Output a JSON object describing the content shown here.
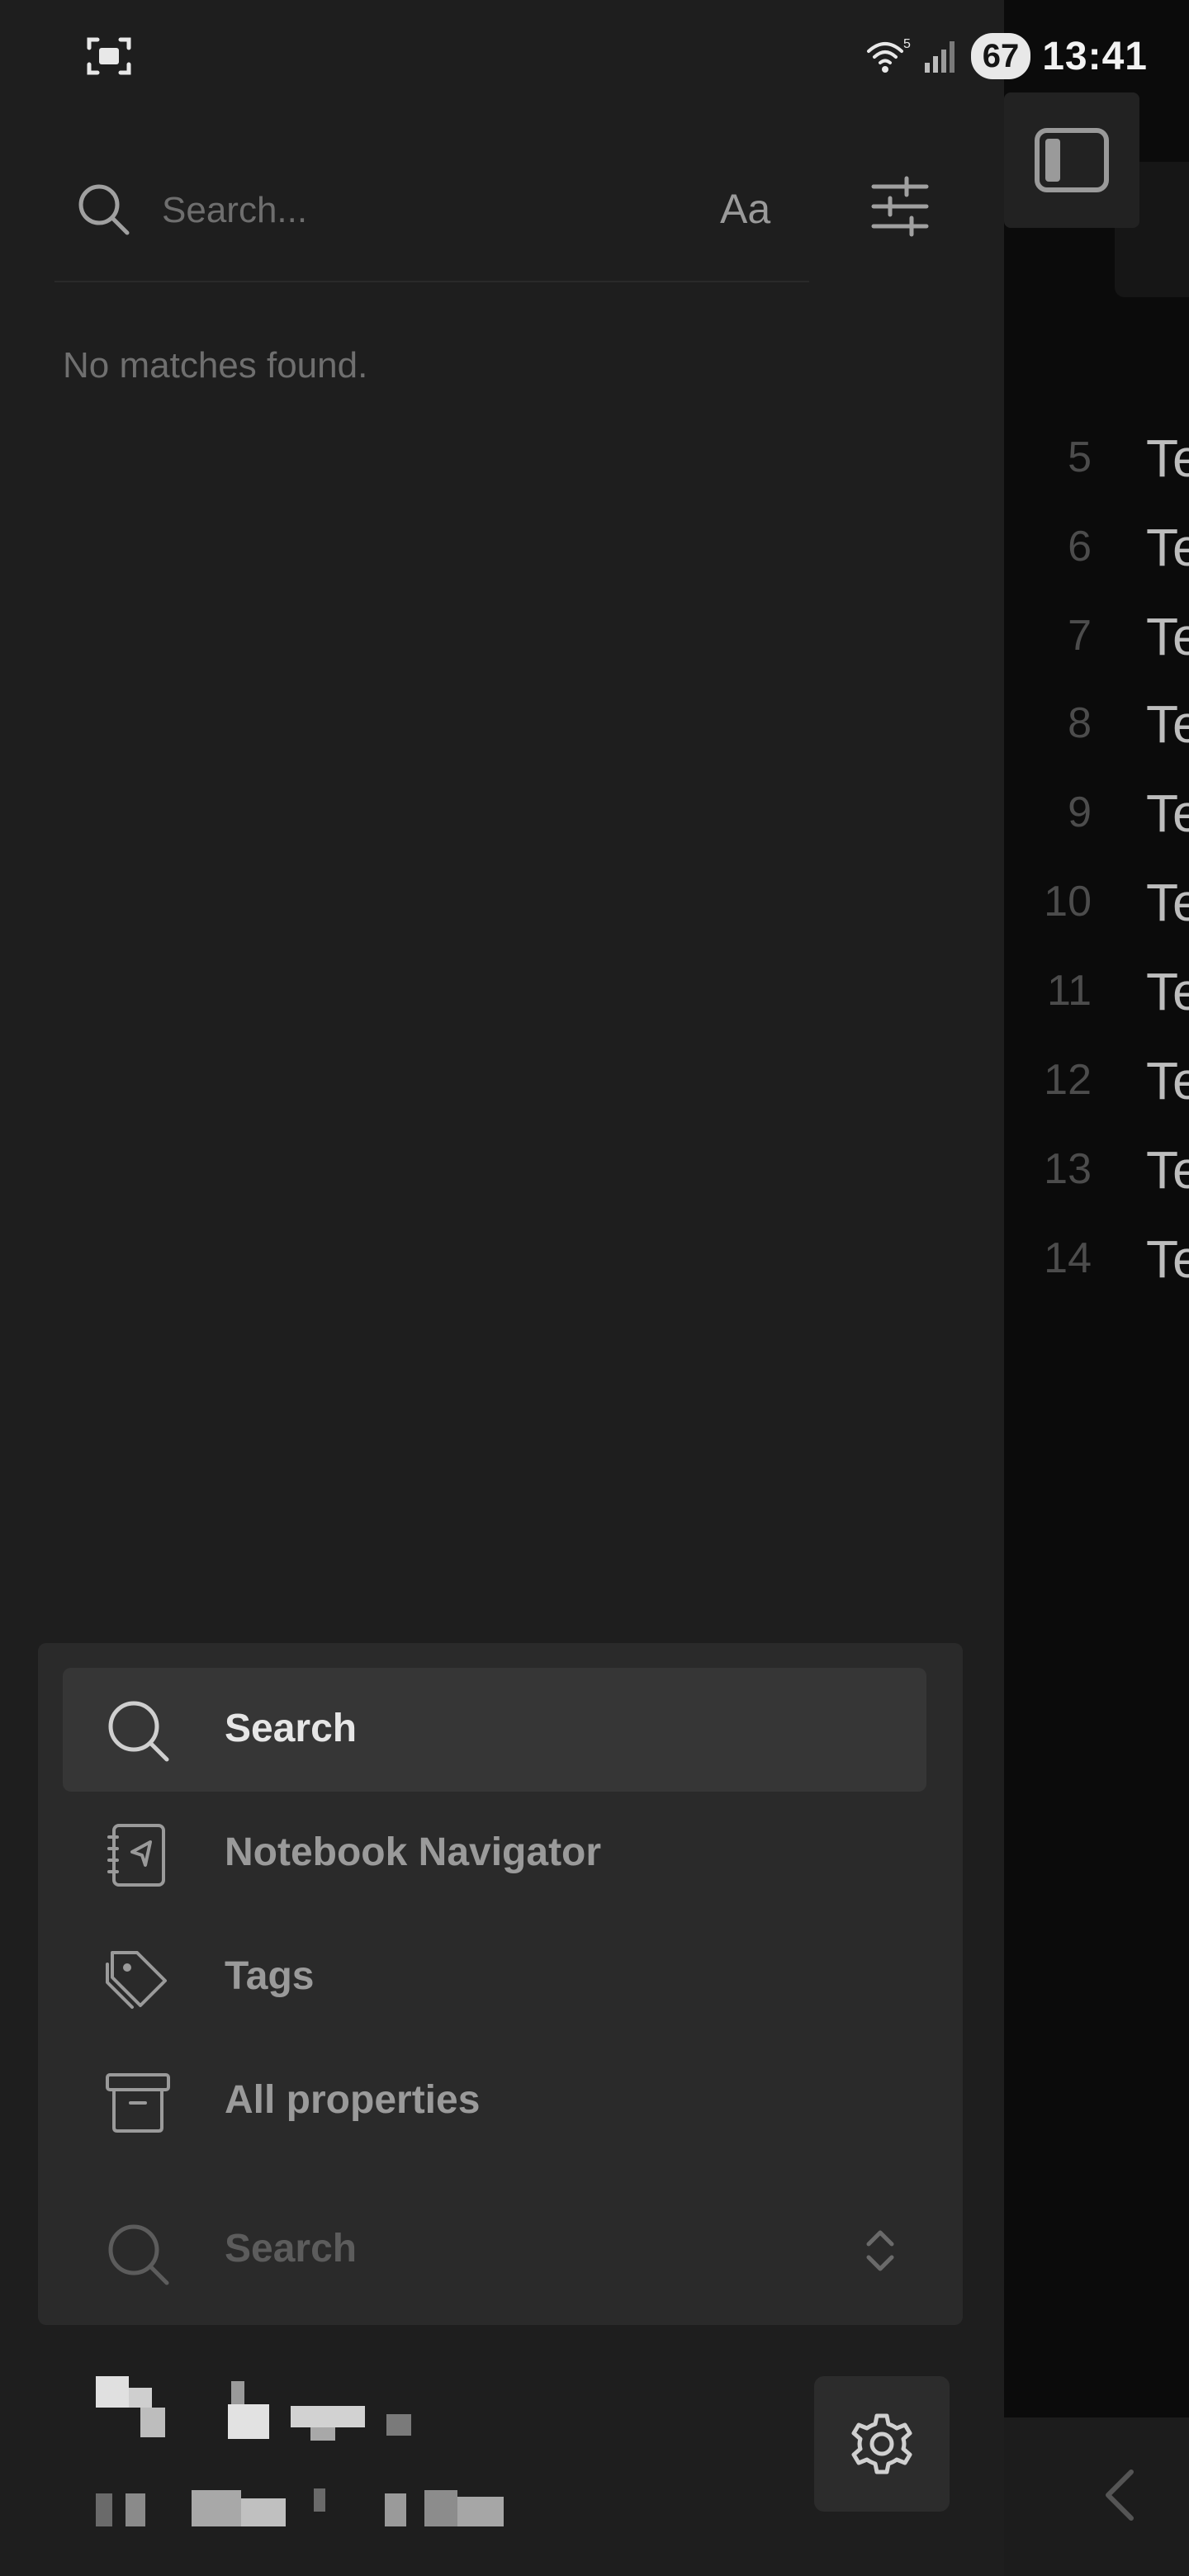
{
  "status_bar": {
    "wifi_label": "5",
    "battery": "67",
    "time": "13:41"
  },
  "search": {
    "placeholder": "Search...",
    "case_toggle": "Aa",
    "empty_message": "No matches found."
  },
  "menu": {
    "items": [
      {
        "label": "Search",
        "icon": "search-icon",
        "active": true
      },
      {
        "label": "Notebook Navigator",
        "icon": "notebook-navigator-icon",
        "active": false
      },
      {
        "label": "Tags",
        "icon": "tags-icon",
        "active": false
      },
      {
        "label": "All properties",
        "icon": "archive-icon",
        "active": false
      }
    ],
    "view_switch_label": "Search"
  },
  "editor": {
    "line_numbers": [
      "5",
      "6",
      "7",
      "8",
      "9",
      "10",
      "11",
      "12",
      "13",
      "14"
    ],
    "line_prefix": "Te"
  },
  "colors": {
    "drawer_bg": "#1e1e1e",
    "panel_bg": "#2a2a2a",
    "active_item_bg": "#363636",
    "editor_bg": "#0b0b0b"
  }
}
